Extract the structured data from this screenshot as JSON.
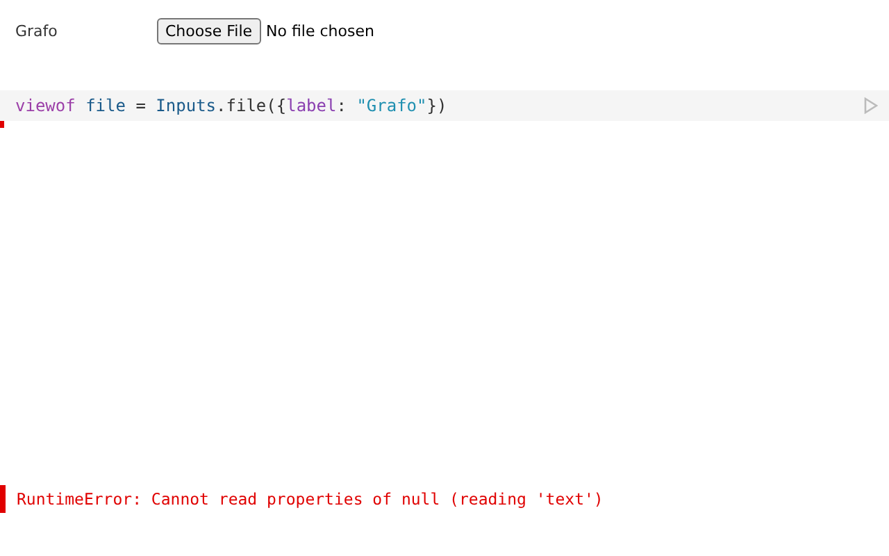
{
  "file_input": {
    "label": "Grafo",
    "button": "Choose File",
    "status": "No file chosen"
  },
  "code_cell": {
    "tokens": [
      {
        "text": "viewof",
        "kind": "keyword"
      },
      {
        "text": "file",
        "kind": "variable"
      },
      {
        "text": " = ",
        "kind": "plain"
      },
      {
        "text": "Inputs",
        "kind": "variable"
      },
      {
        "text": ".file({",
        "kind": "plain"
      },
      {
        "text": "label",
        "kind": "property"
      },
      {
        "text": ": ",
        "kind": "plain"
      },
      {
        "text": "\"Grafo\"",
        "kind": "string"
      },
      {
        "text": "})",
        "kind": "plain"
      }
    ]
  },
  "error": {
    "message": "RuntimeError: Cannot read properties of null (reading 'text')"
  }
}
